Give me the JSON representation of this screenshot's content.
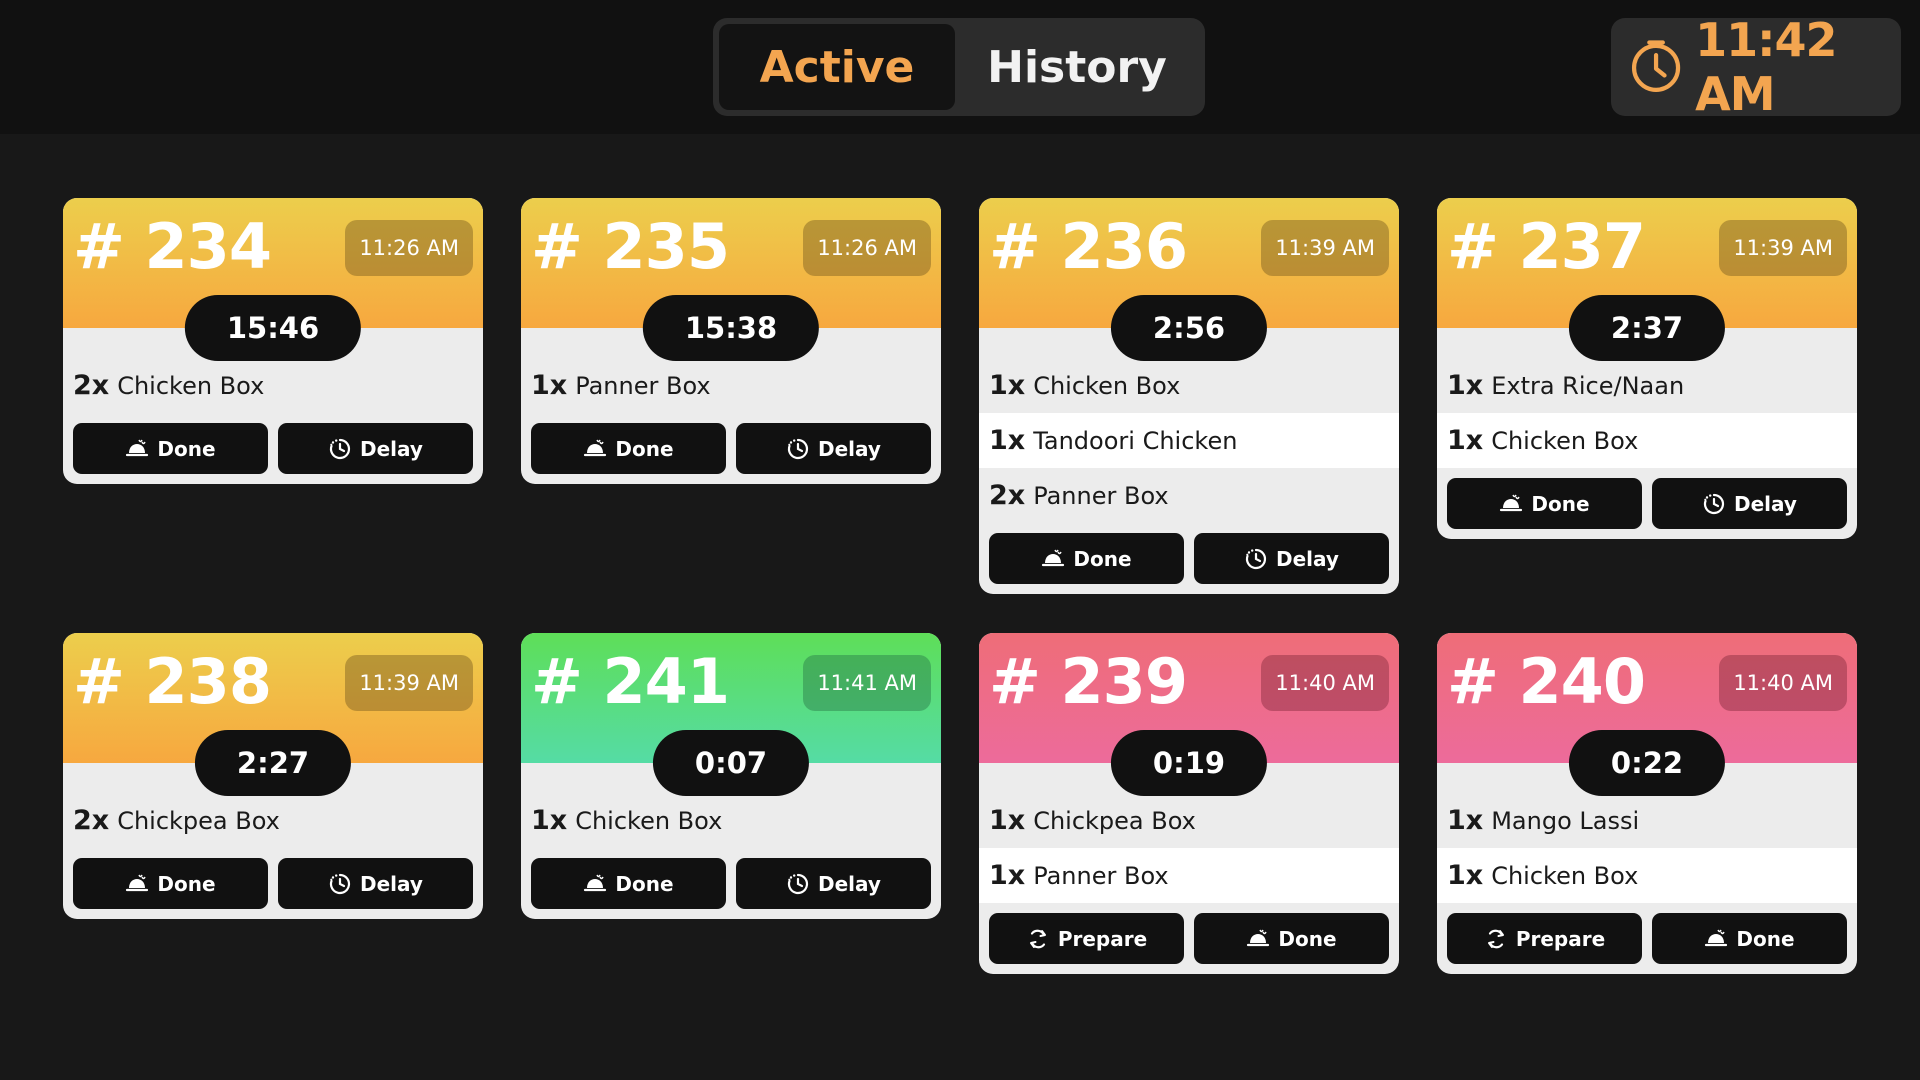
{
  "header": {
    "tabs": [
      {
        "label": "Active",
        "active": true
      },
      {
        "label": "History",
        "active": false
      }
    ],
    "clock": {
      "icon": "clock-icon",
      "time": "11:42 AM",
      "color": "#f3a550"
    }
  },
  "colors": {
    "orange": "#f7a83f",
    "green": "#55dca5",
    "pink": "#ed6b9b",
    "accent": "#f3a550"
  },
  "orders": [
    {
      "number": "# 234",
      "time": "11:26 AM",
      "timer": "15:46",
      "status": "orange",
      "items": [
        {
          "qty": "2x",
          "name": "Chicken Box"
        }
      ],
      "actions": [
        {
          "label": "Done",
          "icon": "cloche-icon"
        },
        {
          "label": "Delay",
          "icon": "delay-clock-icon"
        }
      ]
    },
    {
      "number": "# 235",
      "time": "11:26 AM",
      "timer": "15:38",
      "status": "orange",
      "items": [
        {
          "qty": "1x",
          "name": "Panner Box"
        }
      ],
      "actions": [
        {
          "label": "Done",
          "icon": "cloche-icon"
        },
        {
          "label": "Delay",
          "icon": "delay-clock-icon"
        }
      ]
    },
    {
      "number": "# 236",
      "time": "11:39 AM",
      "timer": "2:56",
      "status": "orange",
      "items": [
        {
          "qty": "1x",
          "name": "Chicken Box"
        },
        {
          "qty": "1x",
          "name": "Tandoori Chicken"
        },
        {
          "qty": "2x",
          "name": "Panner Box"
        }
      ],
      "actions": [
        {
          "label": "Done",
          "icon": "cloche-icon"
        },
        {
          "label": "Delay",
          "icon": "delay-clock-icon"
        }
      ]
    },
    {
      "number": "# 237",
      "time": "11:39 AM",
      "timer": "2:37",
      "status": "orange",
      "items": [
        {
          "qty": "1x",
          "name": "Extra Rice/Naan"
        },
        {
          "qty": "1x",
          "name": "Chicken Box"
        }
      ],
      "actions": [
        {
          "label": "Done",
          "icon": "cloche-icon"
        },
        {
          "label": "Delay",
          "icon": "delay-clock-icon"
        }
      ]
    },
    {
      "number": "# 238",
      "time": "11:39 AM",
      "timer": "2:27",
      "status": "orange",
      "items": [
        {
          "qty": "2x",
          "name": "Chickpea Box"
        }
      ],
      "actions": [
        {
          "label": "Done",
          "icon": "cloche-icon"
        },
        {
          "label": "Delay",
          "icon": "delay-clock-icon"
        }
      ]
    },
    {
      "number": "# 241",
      "time": "11:41 AM",
      "timer": "0:07",
      "status": "green",
      "items": [
        {
          "qty": "1x",
          "name": "Chicken Box"
        }
      ],
      "actions": [
        {
          "label": "Done",
          "icon": "cloche-icon"
        },
        {
          "label": "Delay",
          "icon": "delay-clock-icon"
        }
      ]
    },
    {
      "number": "# 239",
      "time": "11:40 AM",
      "timer": "0:19",
      "status": "pink",
      "items": [
        {
          "qty": "1x",
          "name": "Chickpea Box"
        },
        {
          "qty": "1x",
          "name": "Panner Box"
        }
      ],
      "actions": [
        {
          "label": "Prepare",
          "icon": "refresh-icon"
        },
        {
          "label": "Done",
          "icon": "cloche-icon"
        }
      ]
    },
    {
      "number": "# 240",
      "time": "11:40 AM",
      "timer": "0:22",
      "status": "pink",
      "items": [
        {
          "qty": "1x",
          "name": "Mango Lassi"
        },
        {
          "qty": "1x",
          "name": "Chicken Box"
        }
      ],
      "actions": [
        {
          "label": "Prepare",
          "icon": "refresh-icon"
        },
        {
          "label": "Done",
          "icon": "cloche-icon"
        }
      ]
    }
  ]
}
